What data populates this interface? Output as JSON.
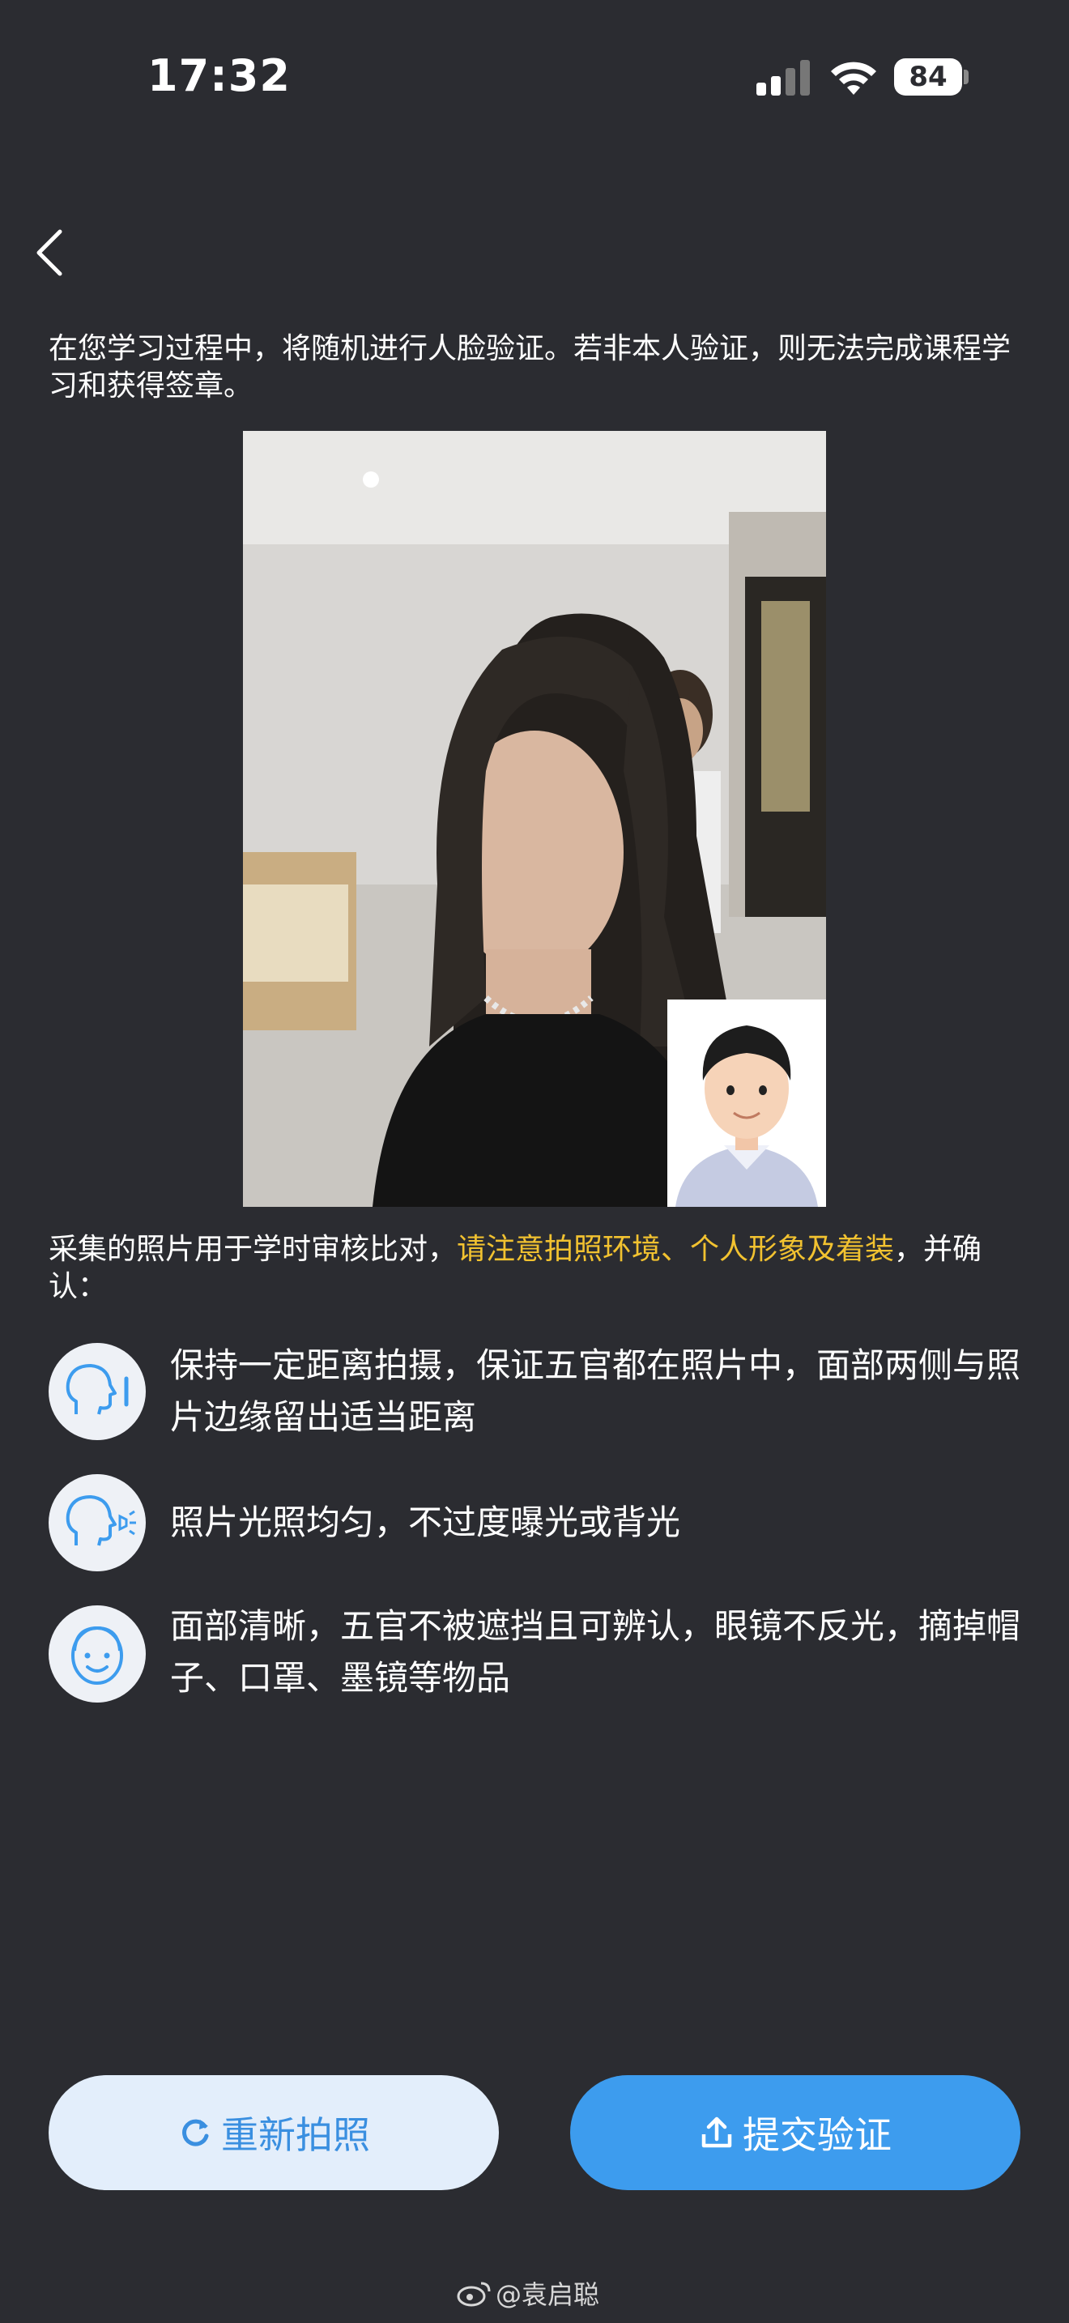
{
  "status_bar": {
    "time": "17:32",
    "battery_level": "84"
  },
  "intro_text": "在您学习过程中，将随机进行人脸验证。若非本人验证，则无法完成课程学习和获得签章。",
  "notice": {
    "prefix": "采集的照片用于学时审核比对，",
    "highlight": "请注意拍照环境、个人形象及着装",
    "suffix": "，并确认：",
    "highlight_color": "#f2c230"
  },
  "tips": [
    {
      "icon": "face-distance-icon",
      "text": "保持一定距离拍摄，保证五官都在照片中，面部两侧与照片边缘留出适当距离"
    },
    {
      "icon": "face-light-icon",
      "text": "照片光照均匀，不过度曝光或背光"
    },
    {
      "icon": "smiling-face-icon",
      "text": "面部清晰，五官不被遮挡且可辨认，眼镜不反光，摘掉帽子、口罩、墨镜等物品"
    }
  ],
  "buttons": {
    "retake": "重新拍照",
    "submit": "提交验证"
  },
  "watermark": "@袁启聪",
  "colors": {
    "background": "#2b2c31",
    "accent": "#3d9cee",
    "retake_bg": "#e3eefb",
    "retake_text": "#3a8fe0"
  }
}
